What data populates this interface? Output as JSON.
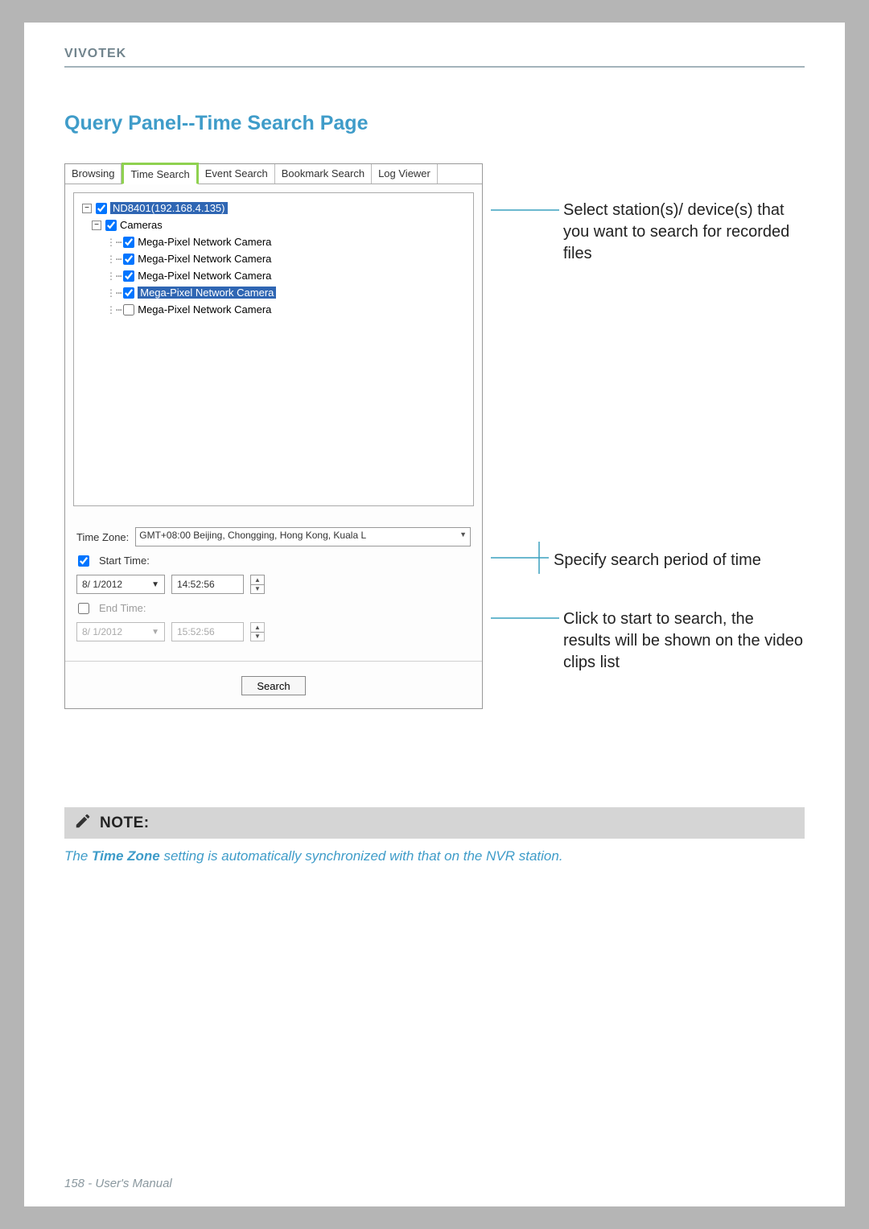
{
  "brand": "VIVOTEK",
  "section_title": "Query Panel--Time Search Page",
  "tabs": {
    "browsing": "Browsing",
    "time_search": "Time Search",
    "event_search": "Event Search",
    "bookmark_search": "Bookmark Search",
    "log_viewer": "Log Viewer"
  },
  "tree": {
    "root": "ND8401(192.168.4.135)",
    "folder": "Cameras",
    "item": "Mega-Pixel Network Camera"
  },
  "timezone": {
    "label": "Time Zone:",
    "value": "GMT+08:00 Beijing, Chongging, Hong Kong, Kuala L"
  },
  "start": {
    "label": "Start Time:",
    "date": "8/ 1/2012",
    "time": "14:52:56"
  },
  "end": {
    "label": "End Time:",
    "date": "8/ 1/2012",
    "time": "15:52:56"
  },
  "search_button": "Search",
  "callouts": {
    "c1": "Select station(s)/ device(s) that you want to search for recorded files",
    "c2": "Specify search period of time",
    "c3": "Click to start to search, the results will be shown on the video clips list"
  },
  "note": {
    "label": "NOTE:",
    "text_pre": "The ",
    "text_bold": "Time Zone",
    "text_post": " setting is automatically synchronized with that on the NVR station."
  },
  "footer": "158 - User's Manual"
}
